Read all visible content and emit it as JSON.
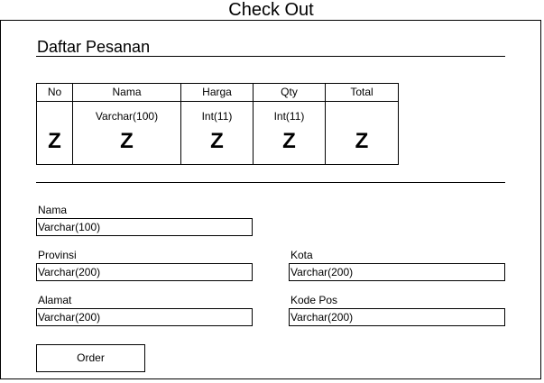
{
  "page": {
    "title": "Check Out"
  },
  "order_list": {
    "title": "Daftar Pesanan",
    "columns": [
      "No",
      "Nama",
      "Harga",
      "Qty",
      "Total"
    ],
    "row": {
      "types": [
        "",
        "Varchar(100)",
        "Int(11)",
        "Int(11)",
        ""
      ],
      "marks": [
        "Z",
        "Z",
        "Z",
        "Z",
        "Z"
      ]
    }
  },
  "form": {
    "nama": {
      "label": "Nama",
      "value": "Varchar(100)"
    },
    "provinsi": {
      "label": "Provinsi",
      "value": "Varchar(200)"
    },
    "kota": {
      "label": "Kota",
      "value": "Varchar(200)"
    },
    "alamat": {
      "label": "Alamat",
      "value": "Varchar(200)"
    },
    "kode_pos": {
      "label": "Kode Pos",
      "value": "Varchar(200)"
    },
    "order_label": "Order"
  }
}
